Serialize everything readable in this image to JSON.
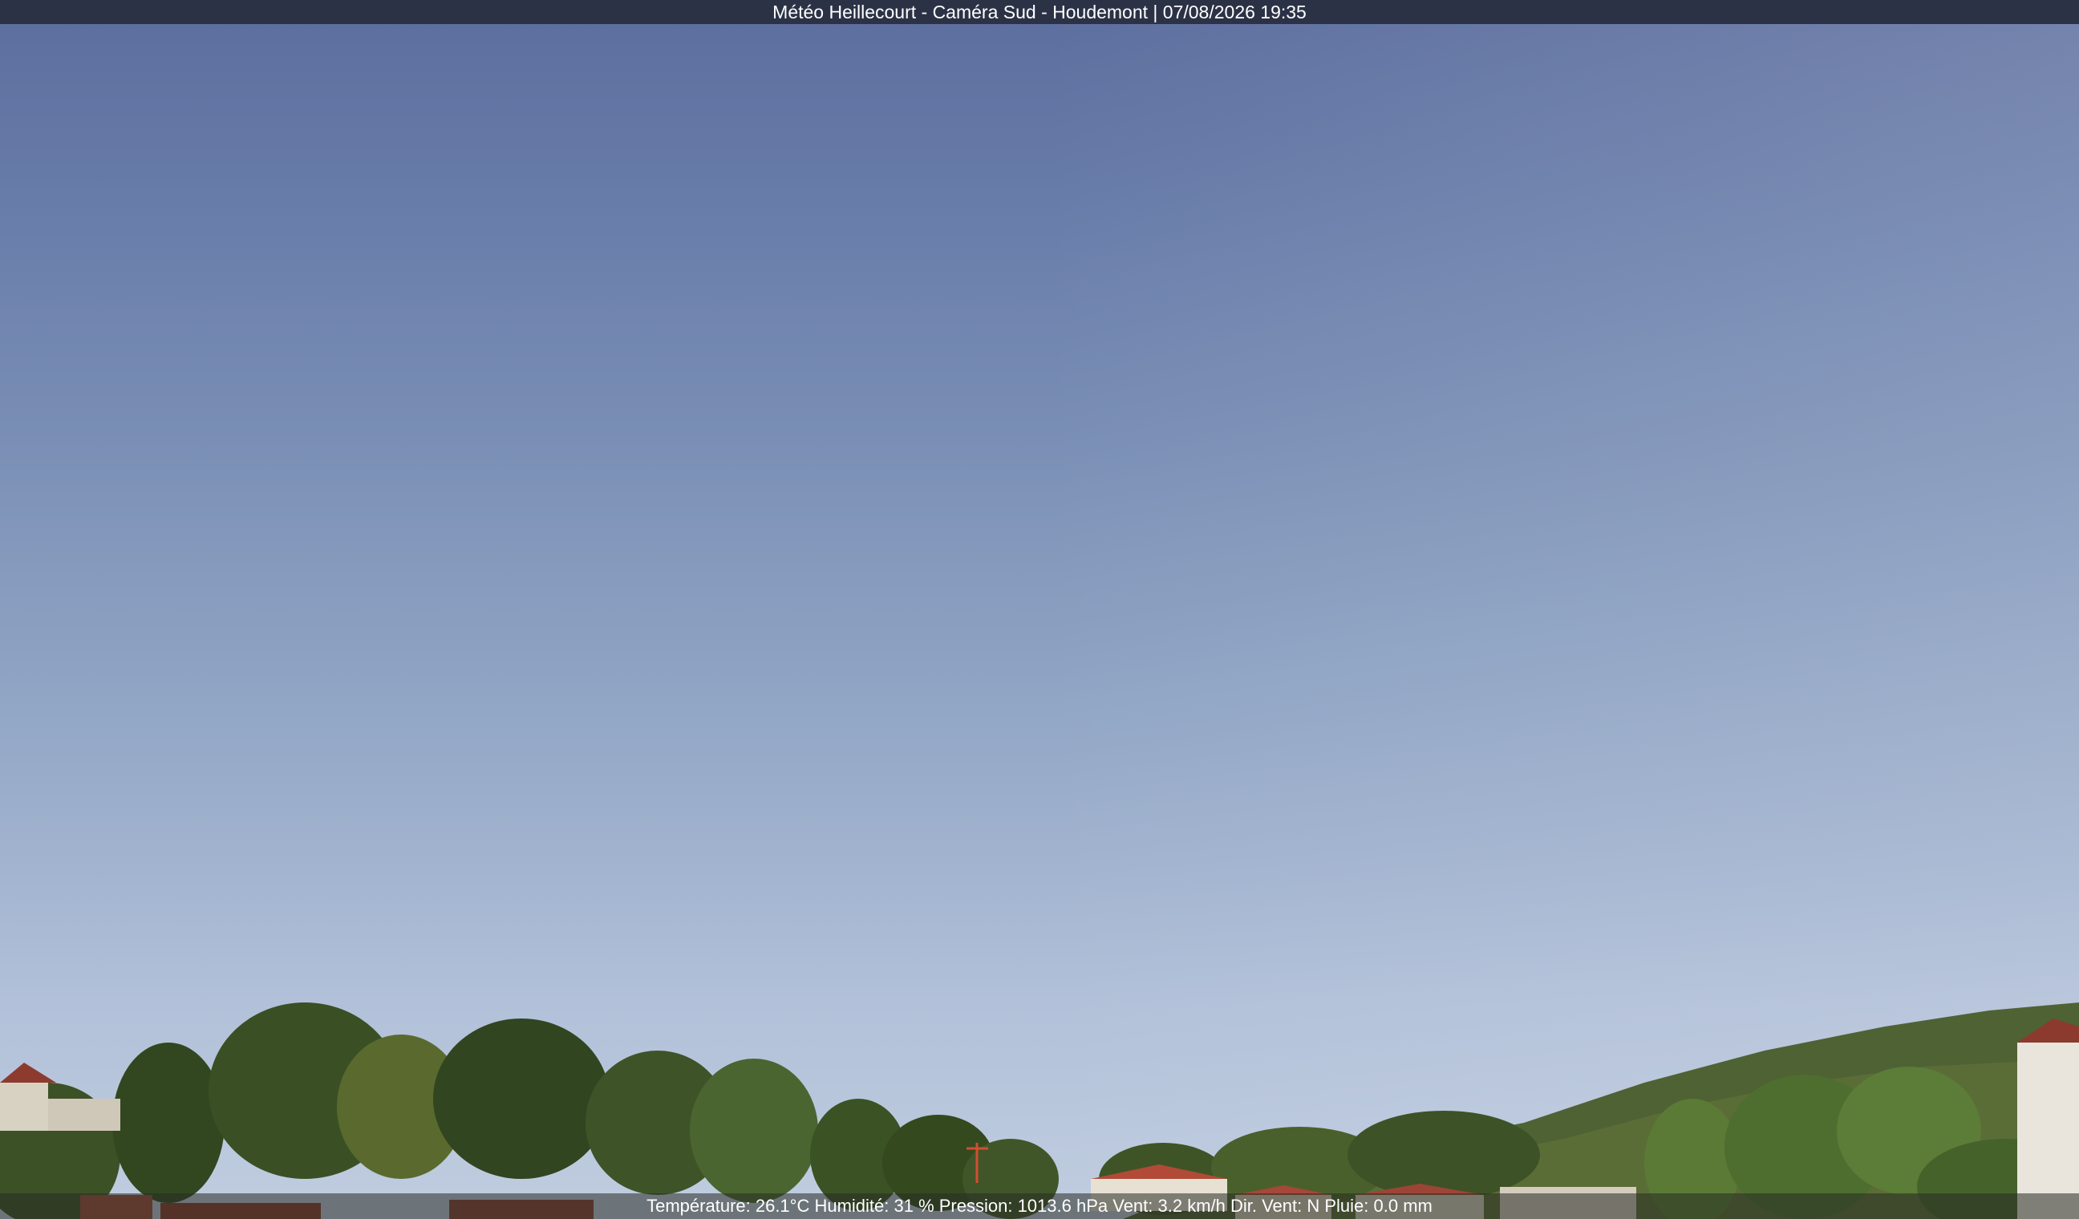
{
  "title_bar": {
    "text": "Météo Heillecourt - Caméra Sud - Houdemont | 07/08/2026 19:35"
  },
  "info_bar": {
    "text": "Température: 26.1°C  Humidité: 31 % Pression: 1013.6 hPa Vent: 3.2 km/h Dir. Vent: N Pluie: 0.0 mm"
  },
  "colors": {
    "sky_top": "#5d6f9f",
    "sky_bottom": "#c0cde0",
    "tree_dark": "#2f3f1f",
    "tree_mid": "#4a5d2c",
    "roof": "#a04a3a"
  }
}
